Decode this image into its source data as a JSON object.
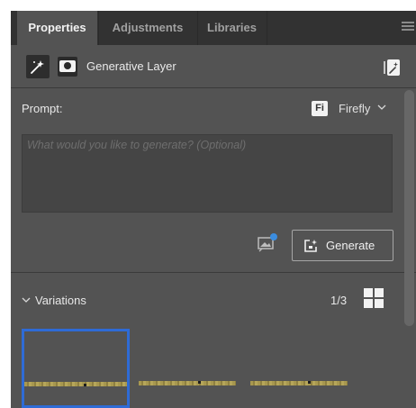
{
  "tabs": [
    {
      "label": "Properties",
      "active": true
    },
    {
      "label": "Adjustments",
      "active": false
    },
    {
      "label": "Libraries",
      "active": false
    }
  ],
  "layer": {
    "name": "Generative Layer",
    "icons": [
      "generative-layer-icon",
      "layer-mask-icon",
      "layer-action-icon"
    ]
  },
  "prompt": {
    "label": "Prompt:",
    "placeholder": "What would you like to generate? (Optional)",
    "value": "",
    "model_badge": "Fi",
    "model_label": "Firefly"
  },
  "actions": {
    "generate_label": "Generate"
  },
  "variations": {
    "label": "Variations",
    "count": "1/3",
    "selected_index": 0
  },
  "colors": {
    "panel_bg": "#535353",
    "tab_bar_bg": "#323232",
    "selection": "#2e6bd6",
    "prompt_box_bg": "#454545"
  }
}
